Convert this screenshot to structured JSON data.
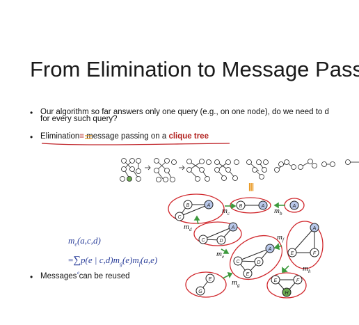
{
  "slide": {
    "title": "From Elimination to Message Passi",
    "bullets": [
      {
        "line1": "Our algorithm so far answers only one query (e.g., on one node), do we need to d",
        "line2": "for every such query?"
      },
      {
        "pre": "Elimination",
        "eq": "≡",
        "mid": " message passing on a ",
        "em": "clique tree"
      },
      {
        "text": "Messages can be reused"
      }
    ],
    "formula": {
      "lhs": "m",
      "lhs_sub": "e",
      "lhs_args": "(a,c,d)",
      "rhs_eq": "=",
      "sum": "∑",
      "sum_sub": "e",
      "rhs": "p(e | c,d)m",
      "rhs_sub1": "g",
      "rhs_mid": "(e)m",
      "rhs_sub2": "f",
      "rhs_end": "(a,e)"
    },
    "equiv_symbol": "|||",
    "message_labels": [
      {
        "base": "m",
        "sub": "c"
      },
      {
        "base": "m",
        "sub": "b"
      },
      {
        "base": "m",
        "sub": "d"
      },
      {
        "base": "m",
        "sub": "f"
      },
      {
        "base": "m",
        "sub": "e"
      },
      {
        "base": "m",
        "sub": "h"
      },
      {
        "base": "m",
        "sub": "g"
      }
    ],
    "node_letters": [
      "A",
      "B",
      "C",
      "D",
      "E",
      "F",
      "G",
      "H"
    ]
  }
}
